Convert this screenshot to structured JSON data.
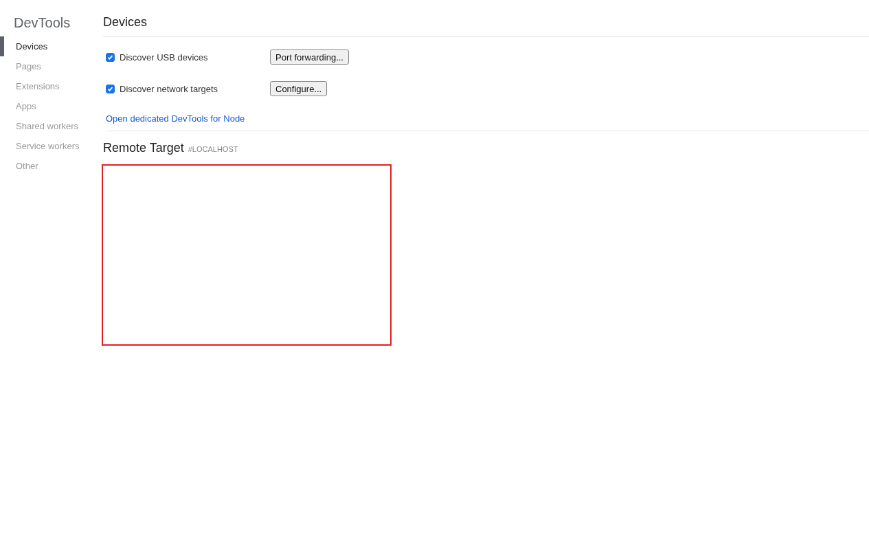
{
  "sidebar": {
    "title": "DevTools",
    "items": [
      {
        "label": "Devices",
        "selected": true
      },
      {
        "label": "Pages",
        "selected": false
      },
      {
        "label": "Extensions",
        "selected": false
      },
      {
        "label": "Apps",
        "selected": false
      },
      {
        "label": "Shared workers",
        "selected": false
      },
      {
        "label": "Service workers",
        "selected": false
      },
      {
        "label": "Other",
        "selected": false
      }
    ]
  },
  "main": {
    "heading": "Devices",
    "options": [
      {
        "label": "Discover USB devices",
        "checked": true,
        "button": "Port forwarding..."
      },
      {
        "label": "Discover network targets",
        "checked": true,
        "button": "Configure..."
      }
    ],
    "link": "Open dedicated DevTools for Node",
    "section": {
      "title": "Remote Target",
      "subtitle": "#LOCALHOST"
    },
    "annotation_box": {
      "shown": true
    }
  }
}
